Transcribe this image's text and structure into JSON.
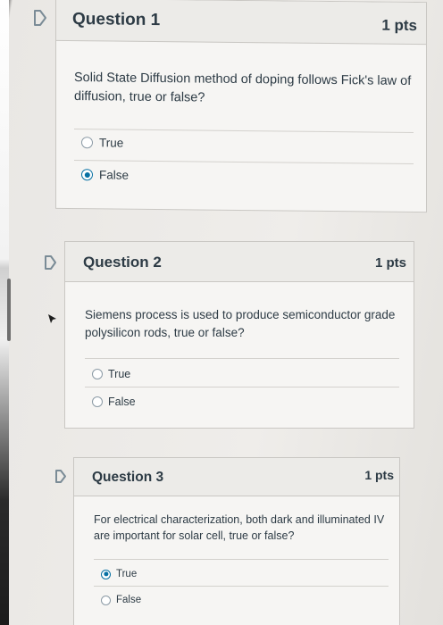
{
  "questions": [
    {
      "title": "Question 1",
      "points": "1 pts",
      "text": "Solid State Diffusion method of doping follows Fick's law of diffusion, true or false?",
      "answers": [
        {
          "label": "True",
          "selected": false
        },
        {
          "label": "False",
          "selected": true
        }
      ]
    },
    {
      "title": "Question 2",
      "points": "1 pts",
      "text": "Siemens process is used to produce semiconductor grade polysilicon rods, true or false?",
      "answers": [
        {
          "label": "True",
          "selected": false
        },
        {
          "label": "False",
          "selected": false
        }
      ]
    },
    {
      "title": "Question 3",
      "points": "1 pts",
      "text": "For electrical characterization, both dark and illuminated IV are important for solar cell, true or false?",
      "answers": [
        {
          "label": "True",
          "selected": true
        },
        {
          "label": "False",
          "selected": false
        }
      ]
    }
  ],
  "icons": {
    "flag": "flag-icon",
    "radio": "radio-icon",
    "cursor": "mouse-cursor-icon"
  },
  "colors": {
    "accent": "#0770a3",
    "text": "#2d3b45",
    "flag_outline": "#7a8b96"
  }
}
